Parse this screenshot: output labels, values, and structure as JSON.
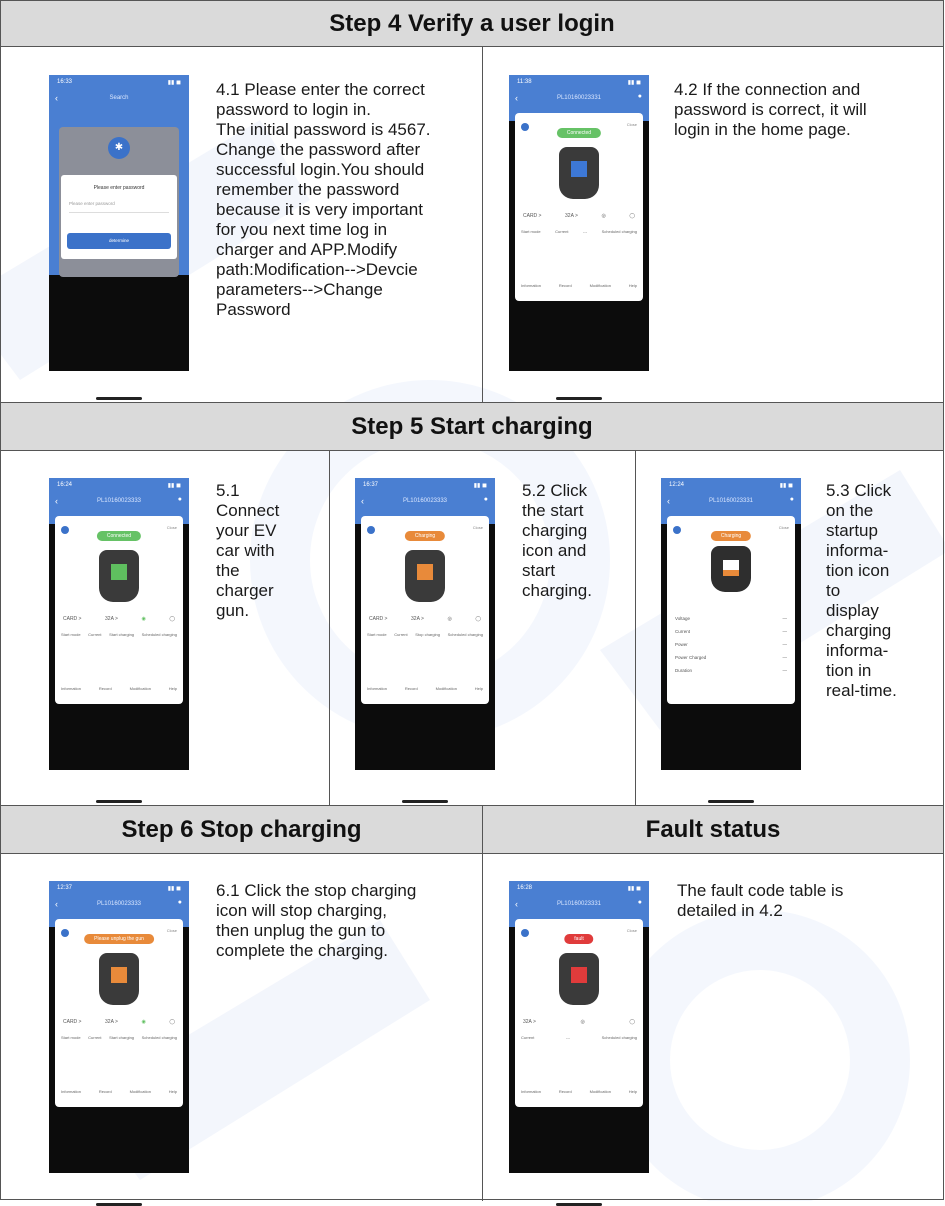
{
  "sections": {
    "step4": {
      "title": "Step 4 Verify a user login"
    },
    "step5": {
      "title": "Step 5 Start charging"
    },
    "step6": {
      "title": "Step 6 Stop charging"
    },
    "fault": {
      "title": "Fault status"
    }
  },
  "texts": {
    "s4_1": "4.1 Please enter the correct\npassword to login in.\nThe initial password is 4567.\nChange the password after\nsuccessful login.You should\nremember the password\nbecause it is very important\nfor you next time log in\ncharger and APP.Modify\npath:Modification-->Devcie\nparameters-->Change\nPassword",
    "s4_2": "4.2 If the connection and\npassword is correct, it will\nlogin in the home page.",
    "s5_1": "5.1\nConnect\nyour EV\ncar with\nthe\ncharger\ngun.",
    "s5_2": "5.2 Click\nthe start\ncharging\nicon and\nstart\ncharging.",
    "s5_3": "5.3 Click\non the\nstartup\ninforma-\ntion icon\nto\ndisplay\ncharging\ninforma-\ntion in\nreal-time.",
    "s6_1": "6.1 Click the stop charging\nicon will stop charging,\nthen unplug the gun to\ncomplete the charging.",
    "fault": "The fault code table is\ndetailed in 4.2"
  },
  "phones": {
    "login": {
      "time": "16:33",
      "title": "Search",
      "dialog_title": "Please enter password",
      "placeholder": "Please enter password",
      "button": "determine"
    },
    "home": {
      "time": "11:38",
      "title": "PL10160023331",
      "status": "Connected",
      "led": "#3d78d6"
    },
    "connect": {
      "time": "16:24",
      "title": "PL10160023333",
      "status": "Connected",
      "led": "#5fbf5f"
    },
    "start": {
      "time": "16:37",
      "title": "PL10160023333",
      "status": "Charging",
      "led": "#e88a3a"
    },
    "info": {
      "time": "12:24",
      "title": "PL10160023331",
      "status": "Charging",
      "led": "#e88a3a"
    },
    "stop": {
      "time": "12:37",
      "title": "PL10160023333",
      "status": "Please unplug the gun",
      "led": "#e88a3a"
    },
    "fault": {
      "time": "16:28",
      "title": "PL10160023331",
      "status": "fault",
      "led": "#e03b3b"
    }
  },
  "phone_labels": {
    "card": "CARD >",
    "current_val": "32A >",
    "start_mode": "Start mode",
    "current": "Current",
    "start_charging": "Start charging",
    "stop_charging": "Stop charging",
    "scheduled": "Scheduled charging",
    "close": "Close",
    "tabs": [
      "Information",
      "Record",
      "Modification",
      "Help"
    ],
    "metrics": [
      "Voltage",
      "Current",
      "Power",
      "Power Charged",
      "Duration"
    ]
  },
  "colors": {
    "header_bg": "#dadada",
    "app_blue": "#4a7fd2"
  }
}
